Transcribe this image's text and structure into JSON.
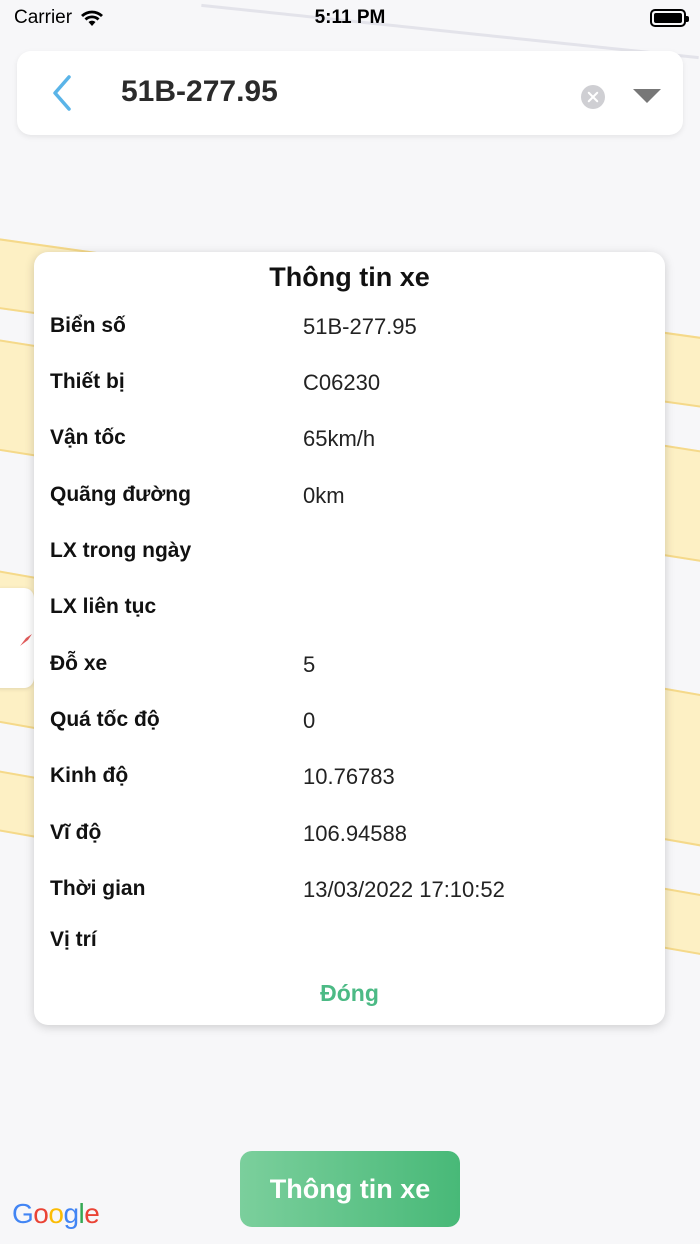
{
  "status_bar": {
    "carrier": "Carrier",
    "time": "5:11 PM"
  },
  "search": {
    "plate": "51B-277.95"
  },
  "modal": {
    "title": "Thông tin xe",
    "rows": [
      {
        "label": "Biển số",
        "value": "51B-277.95"
      },
      {
        "label": "Thiết bị",
        "value": "C06230"
      },
      {
        "label": "Vận tốc",
        "value": "65km/h"
      },
      {
        "label": "Quãng đường",
        "value": "0km"
      },
      {
        "label": "LX trong ngày",
        "value": ""
      },
      {
        "label": "LX liên tục",
        "value": ""
      },
      {
        "label": "Đỗ xe",
        "value": "5"
      },
      {
        "label": "Quá tốc độ",
        "value": "0"
      },
      {
        "label": "Kinh độ",
        "value": "10.76783"
      },
      {
        "label": "Vĩ độ",
        "value": "106.94588"
      },
      {
        "label": "Thời gian",
        "value": "13/03/2022 17:10:52"
      },
      {
        "label": "Vị trí",
        "value": ""
      }
    ],
    "close_label": "Đóng"
  },
  "bottom_button": {
    "label": "Thông tin xe"
  },
  "map": {
    "logo": "Google"
  },
  "colors": {
    "accent_green": "#4cba85",
    "back_blue": "#5ab4e8"
  }
}
